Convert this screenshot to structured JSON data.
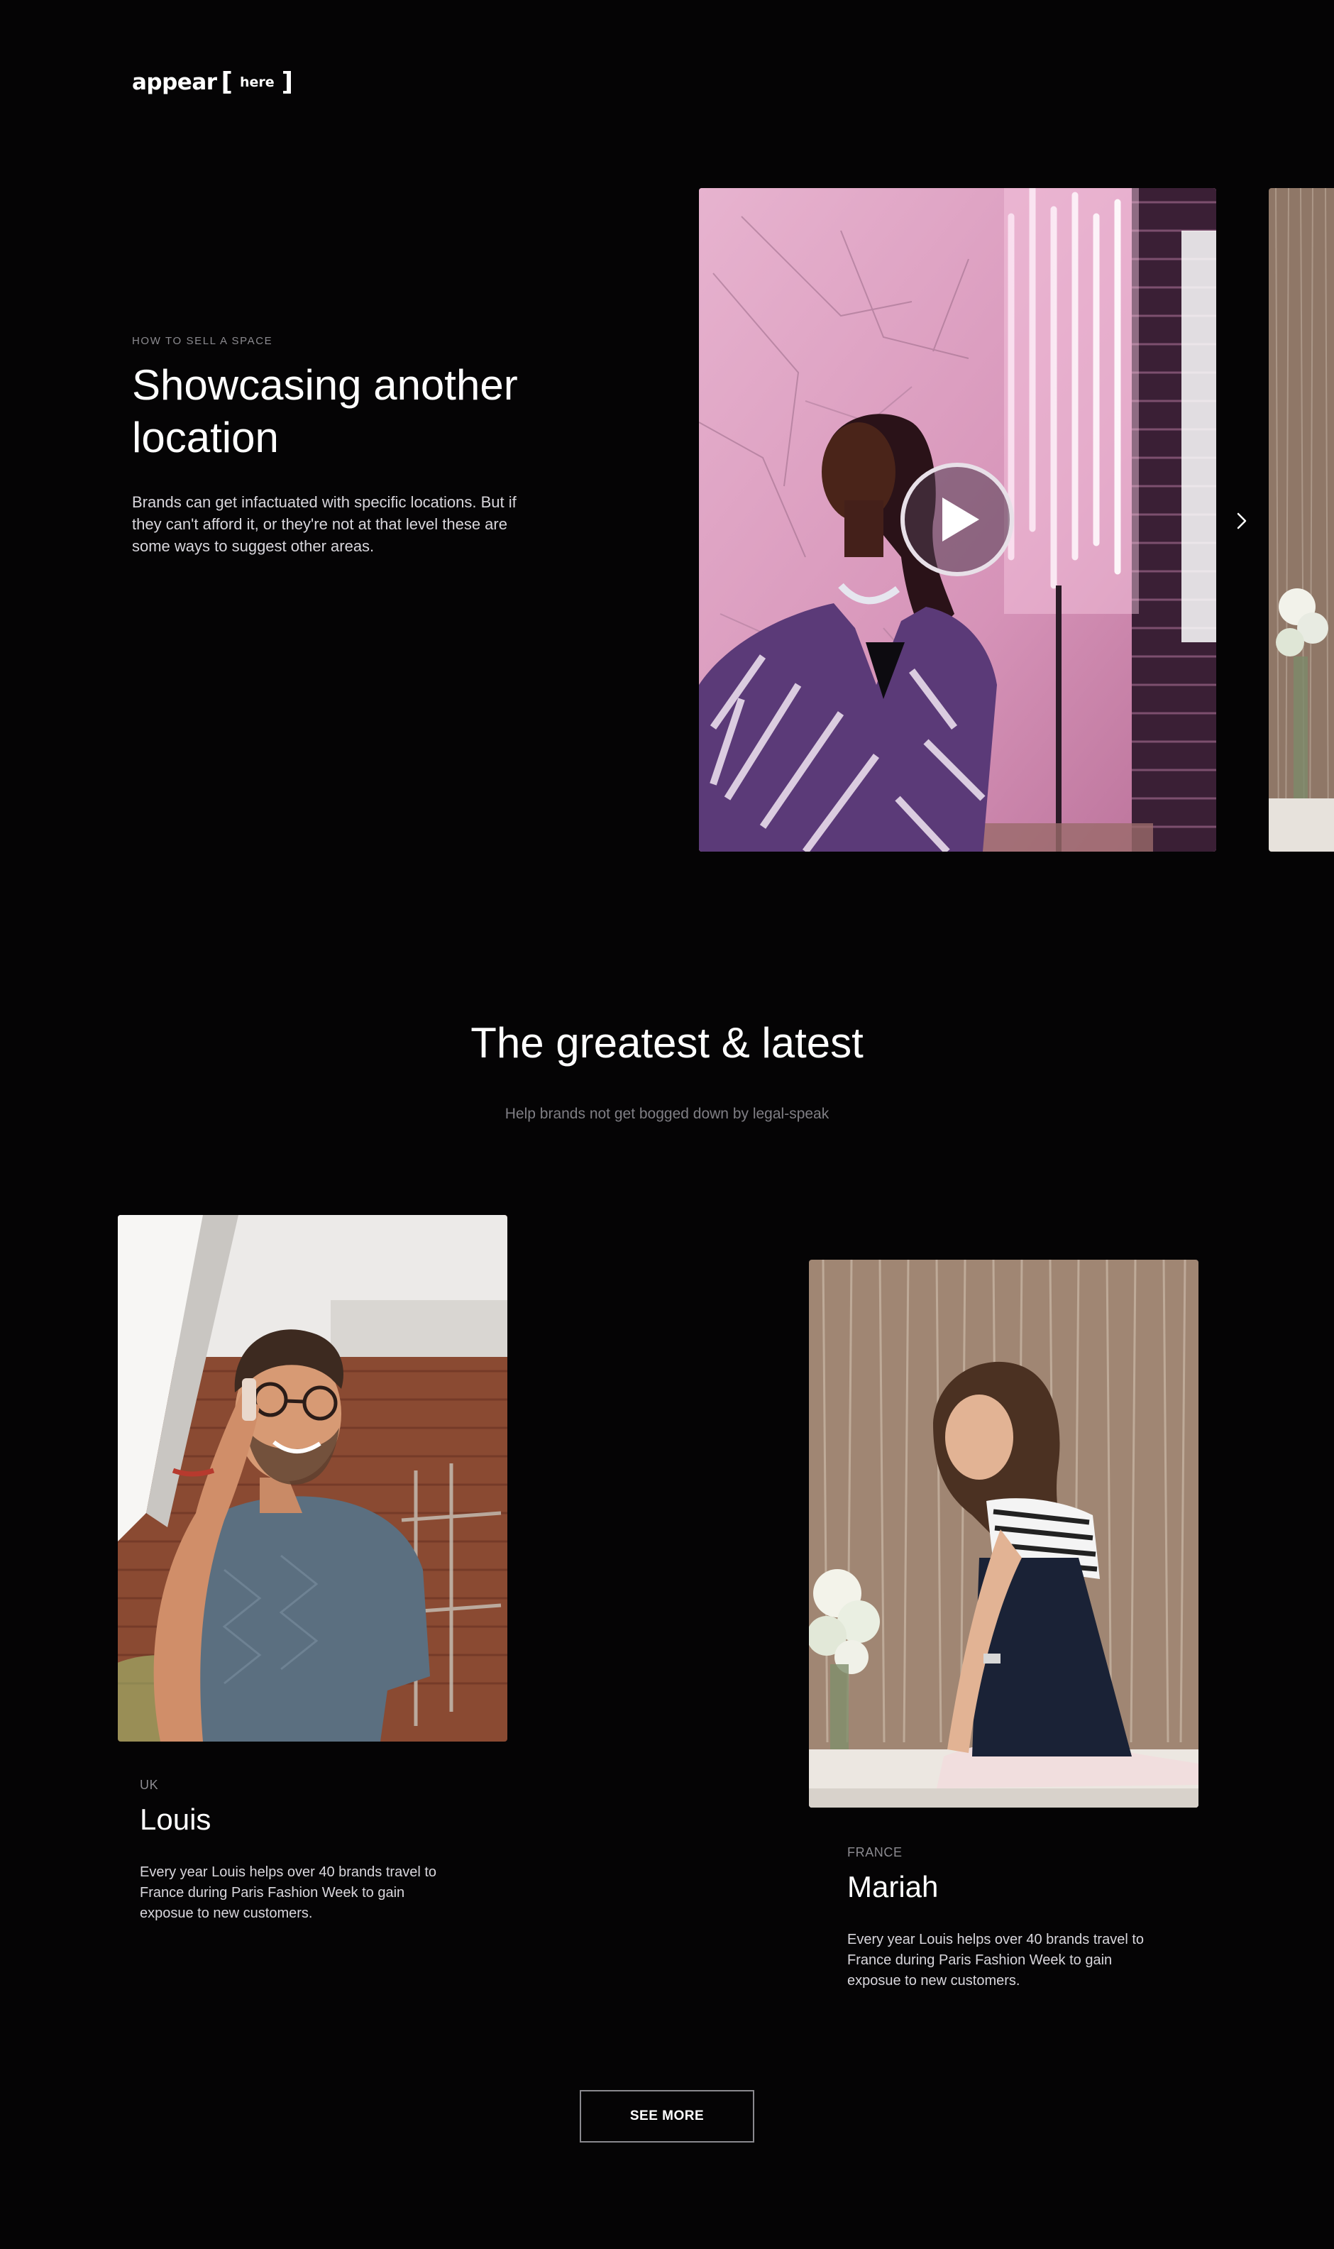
{
  "brand": {
    "word": "appear",
    "bracket_open": "[",
    "sub": "here",
    "bracket_close": "]"
  },
  "hero": {
    "eyebrow": "HOW TO SELL A SPACE",
    "title": "Showcasing another location",
    "description": "Brands can get infactuated with specific locations. But if they can't afford it, or they're not at that level these are some ways to suggest other areas.",
    "play_icon": "play-icon",
    "next_icon": "chevron-right-icon"
  },
  "section": {
    "title": "The greatest & latest",
    "subtitle": "Help brands not get bogged down by legal-speak"
  },
  "profiles": [
    {
      "country": "UK",
      "name": "Louis",
      "description": "Every year Louis helps over 40 brands travel to France during Paris Fashion Week to gain exposue to new customers."
    },
    {
      "country": "FRANCE",
      "name": "Mariah",
      "description": "Every year Louis helps over 40 brands travel to France during Paris Fashion Week to gain exposue to new customers."
    }
  ],
  "cta": {
    "see_more": "SEE MORE"
  },
  "colors": {
    "background": "#050405",
    "text": "#ffffff",
    "muted": "#8b8a8f"
  }
}
